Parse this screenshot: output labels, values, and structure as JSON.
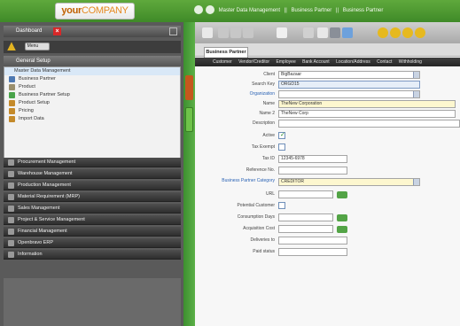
{
  "brand": {
    "logo_part1": "your",
    "logo_part2": "COMPANY"
  },
  "breadcrumb": {
    "items": [
      "Master Data Management",
      "||",
      "Business Partner",
      "||",
      "Business Partner"
    ]
  },
  "sidebar": {
    "header_label": "Dashboard",
    "search_label": "Menu",
    "group_label": "General Setup",
    "items": [
      {
        "label": "Master Data Management"
      },
      {
        "label": "Business Partner"
      },
      {
        "label": "Product"
      },
      {
        "label": "Business Partner Setup"
      },
      {
        "label": "Product Setup"
      },
      {
        "label": "Pricing"
      },
      {
        "label": "Import Data"
      }
    ],
    "categories": [
      {
        "label": "Procurement Management"
      },
      {
        "label": "Warehouse Management"
      },
      {
        "label": "Production Management"
      },
      {
        "label": "Material Requirement (MRP)"
      },
      {
        "label": "Sales Management"
      },
      {
        "label": "Project & Service Management"
      },
      {
        "label": "Financial Management"
      },
      {
        "label": "Openbravo ERP"
      },
      {
        "label": "Information"
      }
    ]
  },
  "main": {
    "tab_label": "Business Partner",
    "subtabs": [
      "Customer",
      "Vendor/Creditor",
      "Employee",
      "Bank Account",
      "Location/Address",
      "Contact",
      "Withholding"
    ],
    "form": {
      "fields": [
        {
          "label": "Client",
          "value": "BigBazaar",
          "kind": "select"
        },
        {
          "label": "Search Key",
          "value": "ORGD15",
          "kind": "text-blue"
        },
        {
          "label": "Organization",
          "value": "",
          "kind": "select"
        },
        {
          "label": "Name",
          "value": "TheNew Corporation",
          "kind": "text-yellow"
        },
        {
          "label": "Name 2",
          "value": "TheNew Corp",
          "kind": "text"
        },
        {
          "label": "Description",
          "value": "",
          "kind": "text-wide"
        },
        {
          "label": "Active",
          "checked": true,
          "kind": "check"
        },
        {
          "label": "Tax Exempt",
          "checked": false,
          "kind": "check"
        },
        {
          "label": "Tax ID",
          "value": "12345-6978",
          "kind": "text-short"
        },
        {
          "label": "Reference No.",
          "value": "",
          "kind": "text-short"
        },
        {
          "label": "Business Partner Category",
          "value": "CREDITOR",
          "kind": "select-yellow"
        },
        {
          "label": "URL",
          "value": "",
          "kind": "text-pick"
        },
        {
          "label": "Potential Customer",
          "checked": false,
          "kind": "check"
        },
        {
          "label": "Consumption Days",
          "value": "",
          "kind": "text-pick"
        },
        {
          "label": "Acquisition Cost",
          "value": "",
          "kind": "text-pick"
        },
        {
          "label": "Deliveries to",
          "value": "",
          "kind": "text-short"
        },
        {
          "label": "Paid status",
          "value": "",
          "kind": "text-short"
        }
      ]
    }
  }
}
